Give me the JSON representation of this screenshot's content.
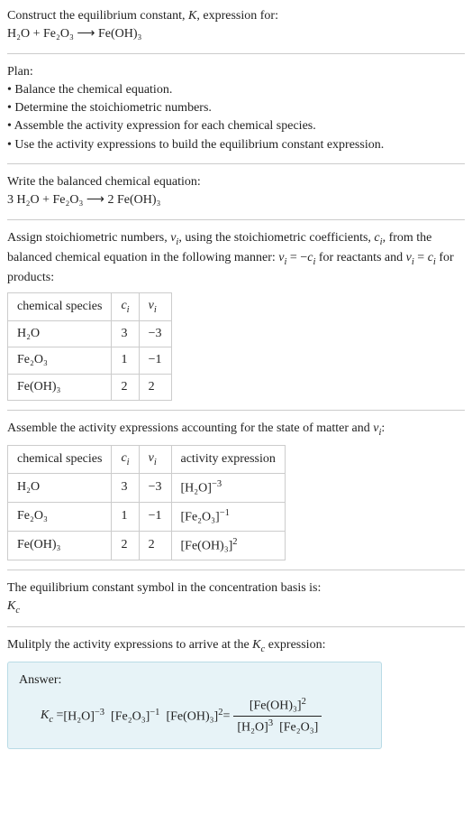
{
  "header": {
    "construct": "Construct the equilibrium constant, ",
    "k": "K",
    "expression_for": ", expression for:",
    "equation_line": "H₂O + Fe₂O₃ ⟶ Fe(OH)₃"
  },
  "plan": {
    "title": "Plan:",
    "b1": "• Balance the chemical equation.",
    "b2": "• Determine the stoichiometric numbers.",
    "b3": "• Assemble the activity expression for each chemical species.",
    "b4": "• Use the activity expressions to build the equilibrium constant expression."
  },
  "balanced": {
    "intro": "Write the balanced chemical equation:",
    "equation": "3 H₂O + Fe₂O₃ ⟶ 2 Fe(OH)₃"
  },
  "assign": {
    "text1": "Assign stoichiometric numbers, ",
    "nu": "ν",
    "i": "i",
    "text2": ", using the stoichiometric coefficients, ",
    "c": "c",
    "text3": ", from the balanced chemical equation in the following manner: ",
    "rel1a": "ν",
    "rel1b": " = −",
    "rel1c": " for reactants and ",
    "rel2a": "ν",
    "rel2b": " = ",
    "rel2c": " for products:"
  },
  "table1": {
    "h_species": "chemical species",
    "h_c": "c",
    "h_nu": "ν",
    "r1_s": "H₂O",
    "r1_c": "3",
    "r1_n": "−3",
    "r2_s": "Fe₂O₃",
    "r2_c": "1",
    "r2_n": "−1",
    "r3_s": "Fe(OH)₃",
    "r3_c": "2",
    "r3_n": "2"
  },
  "assemble": {
    "text1": "Assemble the activity expressions accounting for the state of matter and ",
    "nu": "ν",
    "colon": ":"
  },
  "table2": {
    "h_species": "chemical species",
    "h_c": "c",
    "h_nu": "ν",
    "h_act": "activity expression",
    "r1_s": "H₂O",
    "r1_c": "3",
    "r1_n": "−3",
    "r2_s": "Fe₂O₃",
    "r2_c": "1",
    "r2_n": "−1",
    "r3_s": "Fe(OH)₃",
    "r3_c": "2",
    "r3_n": "2"
  },
  "eqsym": {
    "text": "The equilibrium constant symbol in the concentration basis is:",
    "kc": "K",
    "ksub": "c"
  },
  "multiply": {
    "text1": "Mulitply the activity expressions to arrive at the ",
    "k": "K",
    "ksub": "c",
    "text2": " expression:"
  },
  "answer": {
    "label": "Answer:",
    "kc": "K",
    "ksub": "c",
    "eq": " = "
  },
  "tokens": {
    "H2O": "H₂O",
    "Fe2O3": "Fe₂O₃",
    "FeOH3": "Fe(OH)₃",
    "m3": "−3",
    "m1": "−1",
    "p2": "2",
    "p3": "3",
    "lb": "[",
    "rb": "]"
  }
}
